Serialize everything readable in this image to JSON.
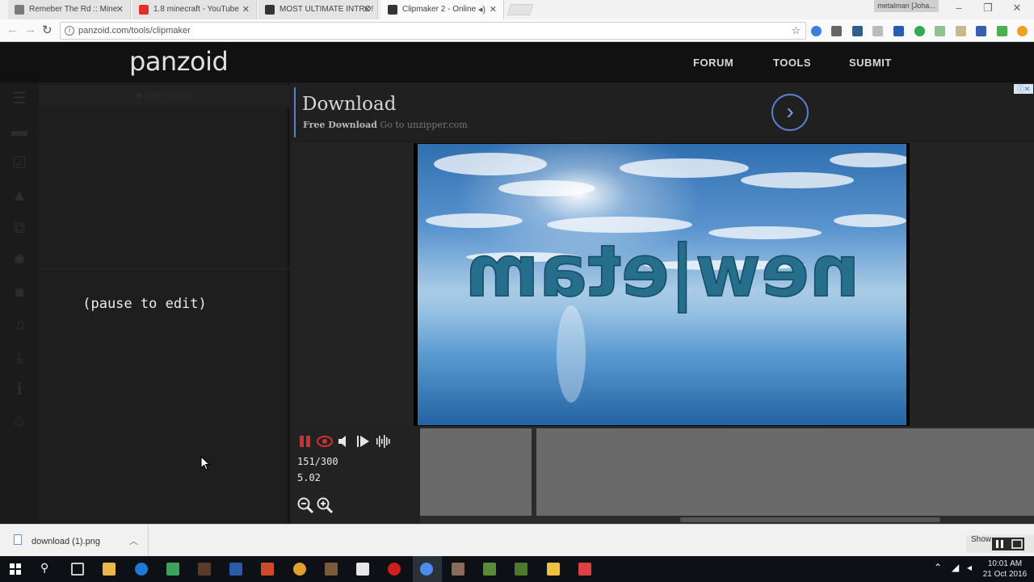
{
  "browser": {
    "tabs": [
      {
        "title": "Remeber The Rd :: Mine",
        "favicon_color": "#7a7a7a"
      },
      {
        "title": "1.8 minecraft - YouTube",
        "favicon_color": "#e52d27"
      },
      {
        "title": "MOST ULTIMATE INTRO!",
        "favicon_color": "#333333"
      },
      {
        "title": "Clipmaker 2 - Online",
        "favicon_color": "#333333"
      }
    ],
    "user_badge": "metalman [Joha...",
    "url": "panzoid.com/tools/clipmaker"
  },
  "site": {
    "logo": "panzoid",
    "nav": [
      "FORUM",
      "TOOLS",
      "SUBMIT"
    ]
  },
  "editor": {
    "pause_message": "(pause to edit)",
    "add_label": "Add to Scen",
    "rail_icons": [
      "menu-icon",
      "folder-icon",
      "checkbox-icon",
      "image-icon",
      "layers-icon",
      "gear-icon",
      "camera-icon",
      "music-icon",
      "download-icon",
      "info-icon",
      "smiley-icon"
    ]
  },
  "ad": {
    "title": "Download",
    "sub_bold": "Free Download",
    "sub_rest": "Go to unzipper.com",
    "arrow": "›"
  },
  "preview": {
    "overlay_text": "new|etam"
  },
  "timeline": {
    "frame": "151/300",
    "time": "5.02"
  },
  "download_bar": {
    "filename": "download (1).png",
    "show_all": "Show"
  },
  "taskbar": {
    "time": "10:01 AM",
    "date": "21 Oct 2016"
  },
  "colors": {
    "accent": "#5a7fd0",
    "header_bg": "#111111",
    "panel_bg": "#1e1e1e",
    "pause_red": "#d03030"
  }
}
